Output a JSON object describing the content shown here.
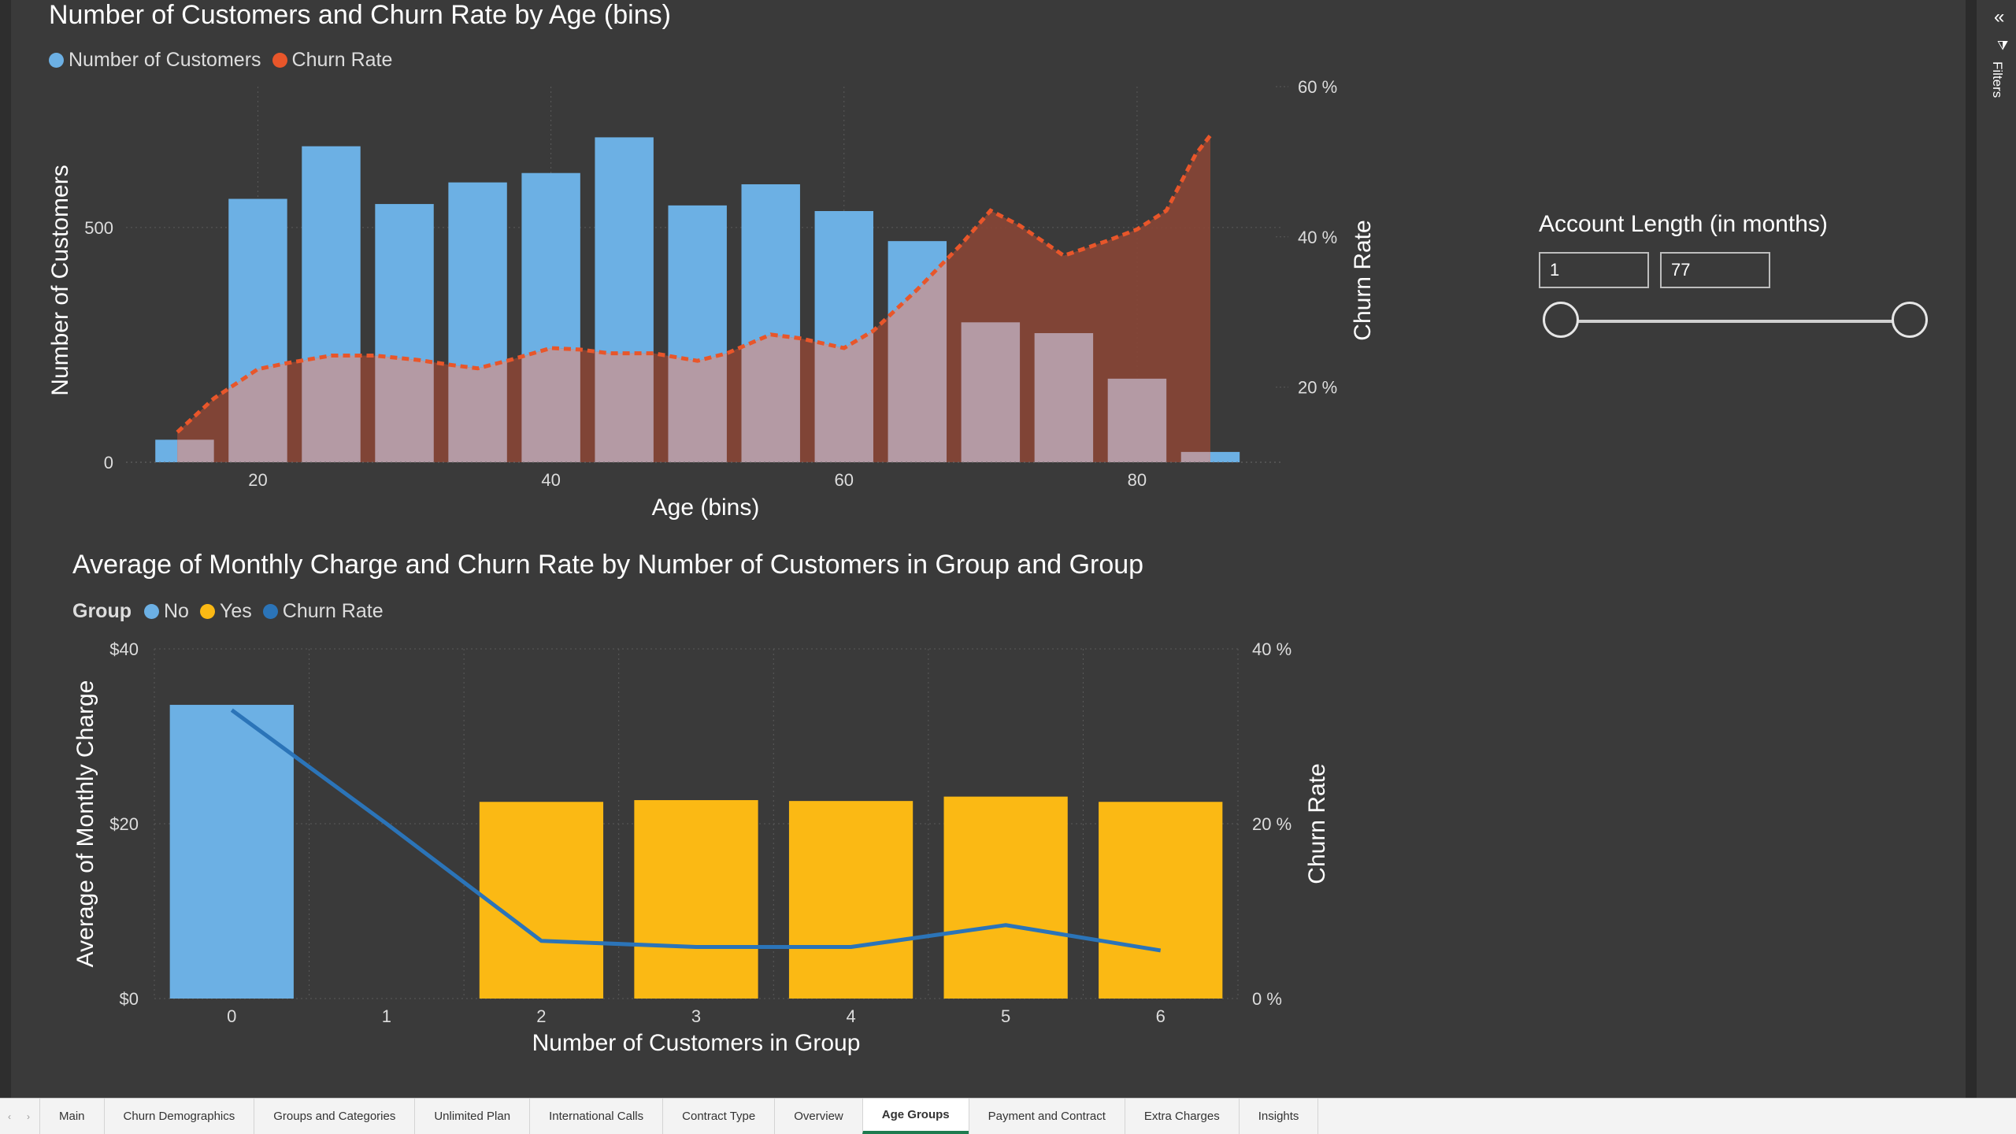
{
  "charts": {
    "age": {
      "title": "Number of Customers and Churn Rate by Age (bins)",
      "legend": [
        {
          "label": "Number of Customers",
          "color": "#6cb0e4"
        },
        {
          "label": "Churn Rate",
          "color": "#e8562a"
        }
      ]
    },
    "group": {
      "title": "Average of Monthly Charge and Churn Rate by Number of Customers in Group and Group",
      "legend_title": "Group",
      "legend": [
        {
          "label": "No",
          "color": "#6cb0e4"
        },
        {
          "label": "Yes",
          "color": "#fbb914"
        },
        {
          "label": "Churn Rate",
          "color": "#2b74b8"
        }
      ]
    }
  },
  "chart_data": [
    {
      "type": "bar",
      "title": "Number of Customers and Churn Rate by Age (bins)",
      "xlabel": "Age (bins)",
      "ylabel": "Number of Customers",
      "y2label": "Churn Rate",
      "x_ticks": [
        "20",
        "40",
        "60",
        "80"
      ],
      "y_ticks": [
        "0",
        "500"
      ],
      "y2_ticks": [
        "20 %",
        "40 %",
        "60 %"
      ],
      "ylim": [
        0,
        800
      ],
      "y2lim": [
        10,
        60
      ],
      "x": [
        15,
        20,
        25,
        30,
        35,
        40,
        45,
        50,
        55,
        60,
        65,
        70,
        75,
        80,
        85
      ],
      "series": [
        {
          "name": "Number of Customers",
          "kind": "bar",
          "color": "#6cb0e4",
          "values": [
            48,
            561,
            673,
            550,
            596,
            616,
            692,
            547,
            592,
            535,
            471,
            298,
            275,
            178,
            22
          ]
        },
        {
          "name": "Churn Rate",
          "kind": "area-dashed-line",
          "color": "#e8562a",
          "area_color": "#8a4536",
          "curve_x": [
            14.5,
            17,
            20,
            22,
            25,
            28,
            31,
            33,
            35,
            37,
            40,
            42,
            44,
            47,
            50,
            52,
            55,
            57,
            60,
            62,
            65,
            68,
            70,
            72,
            75,
            78,
            80,
            82,
            84,
            85
          ],
          "curve_y": [
            14,
            18.5,
            22.4,
            23.2,
            24.2,
            24.2,
            23.6,
            23,
            22.5,
            23.5,
            25.2,
            25,
            24.5,
            24.5,
            23.5,
            24.5,
            27,
            26.5,
            25.2,
            27.5,
            33,
            39,
            43.5,
            41.5,
            37.5,
            39.5,
            41,
            43.5,
            51,
            53.5
          ]
        }
      ],
      "grid": true
    },
    {
      "type": "bar",
      "title": "Average of Monthly Charge and Churn Rate by Number of Customers in Group and Group",
      "xlabel": "Number of Customers in Group",
      "ylabel": "Average of Monthly Charge",
      "y2label": "Churn Rate",
      "categories": [
        "0",
        "1",
        "2",
        "3",
        "4",
        "5",
        "6"
      ],
      "y_ticks": [
        "$0",
        "$20",
        "$40"
      ],
      "y2_ticks": [
        "0 %",
        "20 %",
        "40 %"
      ],
      "ylim": [
        0,
        40
      ],
      "y2lim": [
        0,
        40
      ],
      "legend_title": "Group",
      "series": [
        {
          "name": "No",
          "kind": "bar",
          "color": "#6cb0e4",
          "values": [
            33.6,
            null,
            null,
            null,
            null,
            null,
            null
          ]
        },
        {
          "name": "Yes",
          "kind": "bar",
          "color": "#fbb914",
          "values": [
            null,
            null,
            22.5,
            22.7,
            22.6,
            23.1,
            22.5
          ]
        },
        {
          "name": "Churn Rate",
          "kind": "line",
          "color": "#2b74b8",
          "values": [
            33,
            20,
            6.6,
            5.9,
            5.9,
            8.4,
            5.5
          ]
        }
      ],
      "grid": true
    }
  ],
  "slicer": {
    "title": "Account Length (in months)",
    "min_value": "1",
    "max_value": "77"
  },
  "filters": {
    "label": "Filters",
    "collapse_icon": "double-chevron-left-icon",
    "filter_icon": "funnel-icon"
  },
  "tabs": [
    {
      "label": "Main"
    },
    {
      "label": "Churn Demographics"
    },
    {
      "label": "Groups and Categories"
    },
    {
      "label": "Unlimited Plan"
    },
    {
      "label": "International Calls"
    },
    {
      "label": "Contract Type"
    },
    {
      "label": "Overview"
    },
    {
      "label": "Age Groups",
      "active": true
    },
    {
      "label": "Payment and Contract"
    },
    {
      "label": "Extra Charges"
    },
    {
      "label": "Insights"
    }
  ]
}
